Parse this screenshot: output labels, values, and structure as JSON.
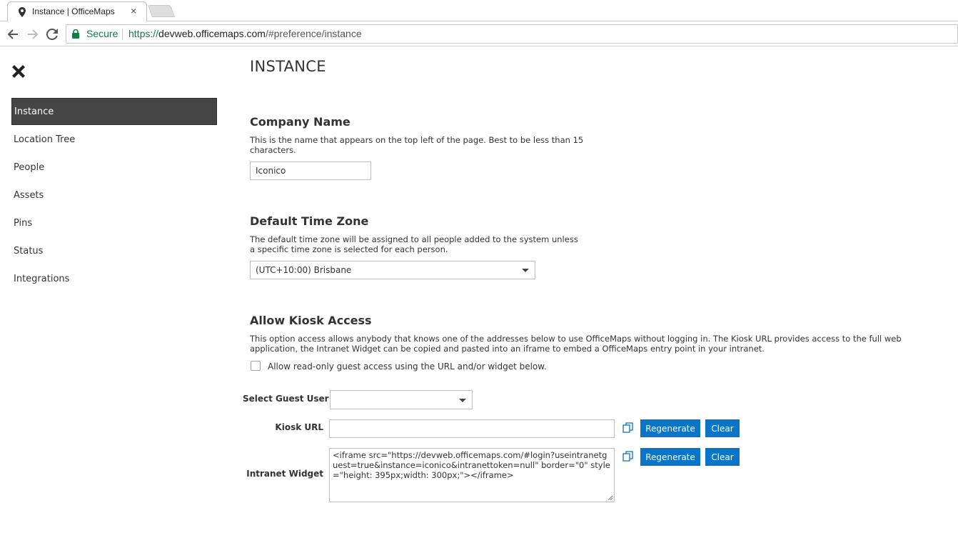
{
  "browser": {
    "tab_title": "Instance | OfficeMaps",
    "tab_close": "×",
    "secure_label": "Secure",
    "url_protocol": "https://",
    "url_host": "devweb.officemaps.com",
    "url_path": "/#preference/instance",
    "secure_color": "#0b8043"
  },
  "sidebar": {
    "items": [
      {
        "label": "Instance",
        "active": true
      },
      {
        "label": "Location Tree"
      },
      {
        "label": "People"
      },
      {
        "label": "Assets"
      },
      {
        "label": "Pins"
      },
      {
        "label": "Status"
      },
      {
        "label": "Integrations"
      }
    ]
  },
  "main": {
    "page_title": "INSTANCE",
    "company": {
      "title": "Company Name",
      "description": "This is the name that appears on the top left of the page. Best to be less than 15 characters.",
      "value": "Iconico"
    },
    "timezone": {
      "title": "Default Time Zone",
      "description": "The default time zone will be assigned to all people added to the system unless a specific time zone is selected for each person.",
      "selected": "(UTC+10:00) Brisbane"
    },
    "kiosk": {
      "title": "Allow Kiosk Access",
      "description": "This option access allows anybody that knows one of the addresses below to use OfficeMaps without logging in. The Kiosk URL provides access to the full web application, the Intranet Widget can be copied and pasted into an iframe to embed a OfficeMaps entry point in your intranet.",
      "checkbox_label": "Allow read-only guest access using the URL and/or widget below.",
      "checked": false,
      "guest_user_label": "Select Guest User",
      "guest_user_value": "",
      "kiosk_url_label": "Kiosk URL",
      "kiosk_url_value": "",
      "widget_label": "Intranet Widget",
      "widget_value": "<iframe src=\"https://devweb.officemaps.com/#login?useintranetguest=true&instance=iconico&intranettoken=null\" border=\"0\" style=\"height: 395px;width: 300px;\"></iframe>",
      "regenerate_label": "Regenerate",
      "clear_label": "Clear"
    }
  },
  "colors": {
    "accent": "#0a74c6",
    "sidebar_active_bg": "#454545"
  }
}
